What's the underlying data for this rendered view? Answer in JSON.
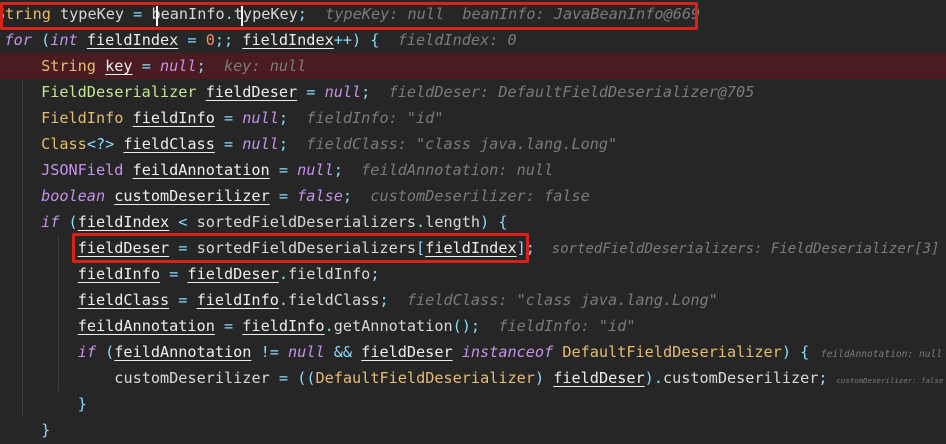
{
  "editor": {
    "breakpoint_line": 2,
    "highlighted_lines": [
      0,
      9
    ],
    "lines": [
      {
        "indent": 0,
        "tokens": [
          [
            "String",
            "t"
          ],
          [
            " typeKey ",
            "p"
          ],
          [
            "=",
            "o"
          ],
          [
            " beanInfo",
            "p"
          ],
          [
            ".",
            "o"
          ],
          [
            "typeKey",
            "p"
          ],
          [
            ";",
            "o"
          ],
          [
            "  typeKey: null  beanInfo: JavaBeanInfo@669",
            "h"
          ]
        ]
      },
      {
        "indent": 0,
        "tokens": [
          [
            "for",
            "k"
          ],
          [
            " (",
            "o"
          ],
          [
            "int",
            "k"
          ],
          [
            " ",
            "p"
          ],
          [
            "fieldIndex",
            "v"
          ],
          [
            " = ",
            "o"
          ],
          [
            "0",
            "num"
          ],
          [
            ";; ",
            "o"
          ],
          [
            "fieldIndex",
            "v"
          ],
          [
            "++) {",
            "o"
          ],
          [
            "  fieldIndex: 0",
            "h"
          ]
        ]
      },
      {
        "indent": 1,
        "tokens": [
          [
            "String",
            "t"
          ],
          [
            " ",
            "p"
          ],
          [
            "key",
            "v"
          ],
          [
            " = ",
            "o"
          ],
          [
            "null",
            "k"
          ],
          [
            ";",
            "o"
          ],
          [
            "  key: null",
            "h"
          ]
        ]
      },
      {
        "indent": 1,
        "tokens": [
          [
            "FieldDeserializer",
            "g"
          ],
          [
            " ",
            "p"
          ],
          [
            "fieldDeser",
            "v"
          ],
          [
            " = ",
            "o"
          ],
          [
            "null",
            "k"
          ],
          [
            ";",
            "o"
          ],
          [
            "  fieldDeser: DefaultFieldDeserializer@705",
            "h"
          ]
        ]
      },
      {
        "indent": 1,
        "tokens": [
          [
            "FieldInfo",
            "t"
          ],
          [
            " ",
            "p"
          ],
          [
            "fieldInfo",
            "v"
          ],
          [
            " = ",
            "o"
          ],
          [
            "null",
            "k"
          ],
          [
            ";",
            "o"
          ],
          [
            "  fieldInfo: \"id\"",
            "h"
          ]
        ]
      },
      {
        "indent": 1,
        "tokens": [
          [
            "Class",
            "t"
          ],
          [
            "<?>",
            "o"
          ],
          [
            " ",
            "p"
          ],
          [
            "fieldClass",
            "v"
          ],
          [
            " = ",
            "o"
          ],
          [
            "null",
            "k"
          ],
          [
            ";",
            "o"
          ],
          [
            "  fieldClass: \"class java.lang.Long\"",
            "h"
          ]
        ]
      },
      {
        "indent": 1,
        "tokens": [
          [
            "JSONField",
            "j"
          ],
          [
            " ",
            "p"
          ],
          [
            "feildAnnotation",
            "v"
          ],
          [
            " = ",
            "o"
          ],
          [
            "null",
            "k"
          ],
          [
            ";",
            "o"
          ],
          [
            "  feildAnnotation: null",
            "h"
          ]
        ]
      },
      {
        "indent": 1,
        "tokens": [
          [
            "boolean",
            "k"
          ],
          [
            " ",
            "p"
          ],
          [
            "customDeserilizer",
            "v"
          ],
          [
            " = ",
            "o"
          ],
          [
            "false",
            "k"
          ],
          [
            ";",
            "o"
          ],
          [
            "  customDeserilizer: false",
            "h"
          ]
        ]
      },
      {
        "indent": 1,
        "tokens": [
          [
            "if",
            "k"
          ],
          [
            " (",
            "o"
          ],
          [
            "fieldIndex",
            "v"
          ],
          [
            " < ",
            "o"
          ],
          [
            "sortedFieldDeserializers",
            "p"
          ],
          [
            ".",
            "o"
          ],
          [
            "length",
            "p"
          ],
          [
            ") {",
            "o"
          ]
        ]
      },
      {
        "indent": 2,
        "tokens": [
          [
            "fieldDeser",
            "v"
          ],
          [
            " = ",
            "o"
          ],
          [
            "sortedFieldDeserializers",
            "p"
          ],
          [
            "[",
            "o"
          ],
          [
            "fieldIndex",
            "v"
          ],
          [
            "];",
            "o"
          ],
          [
            "  sortedFieldDeserializers: FieldDeserializer[3]",
            "h"
          ]
        ]
      },
      {
        "indent": 2,
        "tokens": [
          [
            "fieldInfo",
            "v"
          ],
          [
            " = ",
            "o"
          ],
          [
            "fieldDeser",
            "v"
          ],
          [
            ".",
            "o"
          ],
          [
            "fieldInfo",
            "p"
          ],
          [
            ";",
            "o"
          ]
        ]
      },
      {
        "indent": 2,
        "tokens": [
          [
            "fieldClass",
            "v"
          ],
          [
            " = ",
            "o"
          ],
          [
            "fieldInfo",
            "v"
          ],
          [
            ".",
            "o"
          ],
          [
            "fieldClass",
            "p"
          ],
          [
            ";",
            "o"
          ],
          [
            "  fieldClass: \"class java.lang.Long\"",
            "h"
          ]
        ]
      },
      {
        "indent": 2,
        "tokens": [
          [
            "feildAnnotation",
            "v"
          ],
          [
            " = ",
            "o"
          ],
          [
            "fieldInfo",
            "v"
          ],
          [
            ".",
            "o"
          ],
          [
            "getAnnotation",
            "p"
          ],
          [
            "();",
            "o"
          ],
          [
            "  fieldInfo: \"id\"",
            "h"
          ]
        ]
      },
      {
        "indent": 2,
        "tokens": [
          [
            "if",
            "k"
          ],
          [
            " (",
            "o"
          ],
          [
            "feildAnnotation",
            "v"
          ],
          [
            " != ",
            "o"
          ],
          [
            "null",
            "k"
          ],
          [
            " && ",
            "o"
          ],
          [
            "fieldDeser",
            "v"
          ],
          [
            " ",
            "p"
          ],
          [
            "instanceof",
            "k"
          ],
          [
            " ",
            "p"
          ],
          [
            "DefaultFieldDeserializer",
            "t"
          ],
          [
            ") {",
            "o"
          ],
          [
            "  feildAnnotation: null",
            "h"
          ]
        ]
      },
      {
        "indent": 3,
        "tokens": [
          [
            "customDeserilizer",
            "p"
          ],
          [
            " = ",
            "o"
          ],
          [
            "((",
            "o"
          ],
          [
            "DefaultFieldDeserializer",
            "t"
          ],
          [
            ") ",
            "o"
          ],
          [
            "fieldDeser",
            "v"
          ],
          [
            ").",
            "o"
          ],
          [
            "customDeserilizer",
            "p"
          ],
          [
            ";",
            "o"
          ],
          [
            "  customDeserilizer: false",
            "h"
          ]
        ]
      },
      {
        "indent": 2,
        "tokens": [
          [
            "}",
            "o"
          ]
        ]
      },
      {
        "indent": 1,
        "tokens": [
          [
            "}",
            "o"
          ]
        ]
      }
    ]
  }
}
